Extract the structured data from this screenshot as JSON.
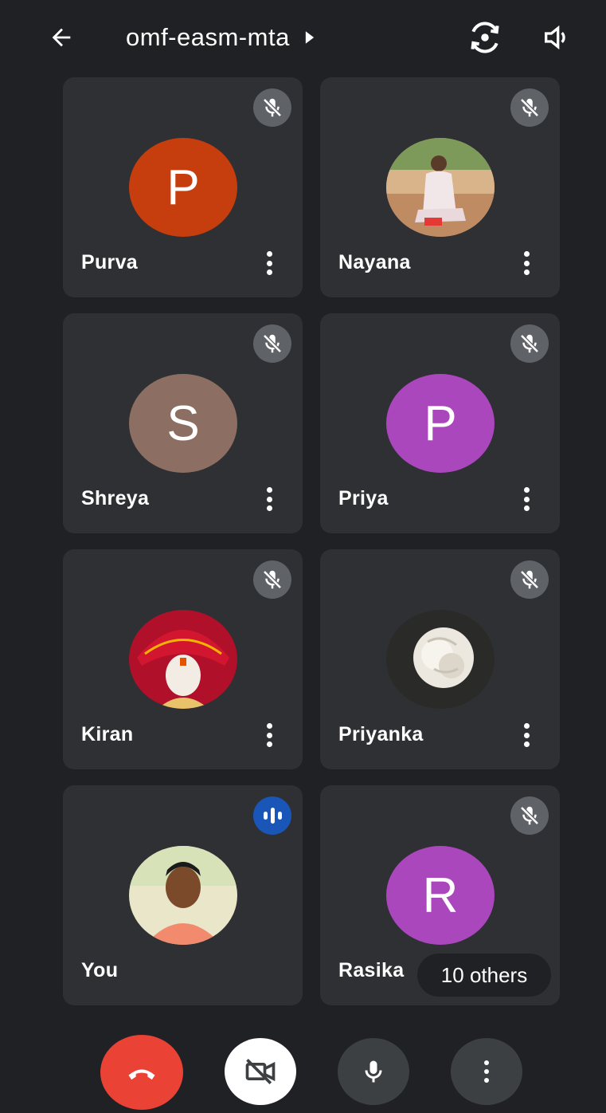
{
  "header": {
    "meeting_code": "omf-easm-mta",
    "back_icon": "arrow-back-icon",
    "expand_icon": "play-arrow-icon",
    "switch_camera_icon": "switch-camera-icon",
    "speaker_icon": "volume-icon"
  },
  "participants": [
    {
      "name": "Purva",
      "initial": "P",
      "avatar_color": "#c73e0e",
      "audio": "muted",
      "avatar_type": "initial"
    },
    {
      "name": "Nayana",
      "avatar_type": "photo",
      "photo_icon": "woman-sitting-photo",
      "audio": "muted"
    },
    {
      "name": "Shreya",
      "initial": "S",
      "avatar_color": "#8d6e63",
      "audio": "muted",
      "avatar_type": "initial"
    },
    {
      "name": "Priya",
      "initial": "P",
      "avatar_color": "#ab47bc",
      "audio": "muted",
      "avatar_type": "initial"
    },
    {
      "name": "Kiran",
      "avatar_type": "photo",
      "photo_icon": "turban-idol-photo",
      "audio": "muted"
    },
    {
      "name": "Priyanka",
      "avatar_type": "photo",
      "photo_icon": "white-rose-photo",
      "audio": "muted"
    },
    {
      "name": "You",
      "avatar_type": "photo",
      "photo_icon": "man-portrait-photo",
      "audio": "speaking"
    },
    {
      "name": "Rasika",
      "initial": "R",
      "avatar_color": "#ab47bc",
      "audio": "muted",
      "avatar_type": "initial"
    }
  ],
  "others_label": "10 others",
  "controls": {
    "end_call_icon": "end-call-icon",
    "camera_icon": "camera-off-icon",
    "mic_icon": "mic-icon",
    "more_icon": "more-vert-icon"
  },
  "colors": {
    "background": "#202124",
    "tile": "#2f3033",
    "end_call": "#ea4335",
    "speaking_indicator": "#1a56b8"
  }
}
